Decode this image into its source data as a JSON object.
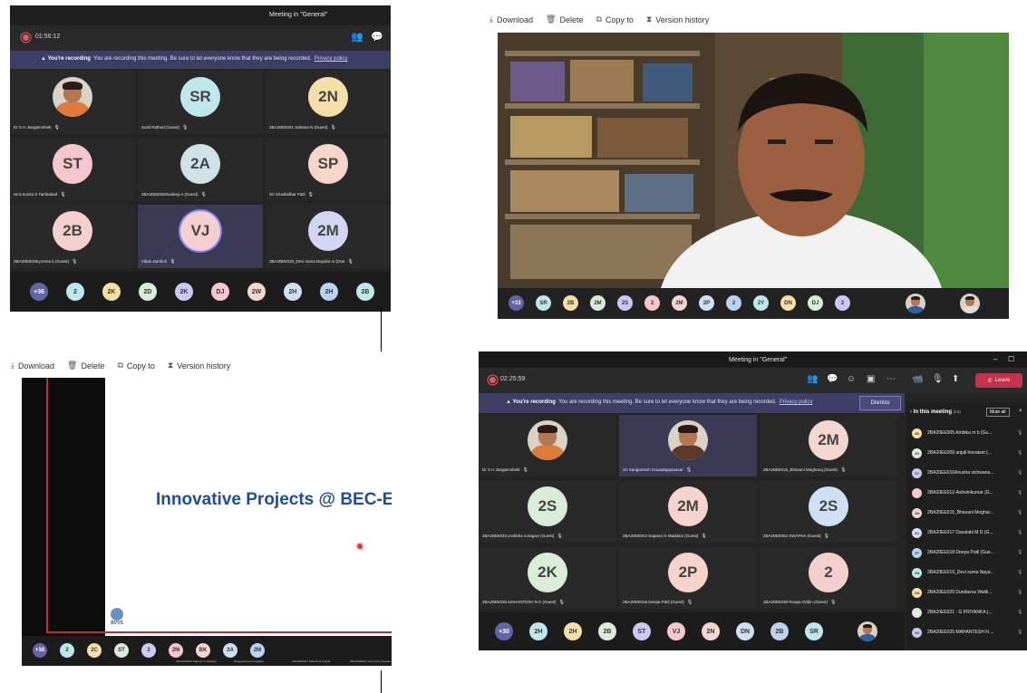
{
  "q1": {
    "meeting_title": "Meeting in \"General\"",
    "timer": "01:56:12",
    "banner_bold": "You're recording",
    "banner_text": "You are recording this meeting. Be sure to let everyone know that they are being recorded.",
    "banner_link": "Privacy policy",
    "tiles": [
      {
        "name": "Dr S H Jangamshetti",
        "initials": "",
        "color": "#ffffff"
      },
      {
        "name": "Sunil Rathod (Guest)",
        "initials": "SR",
        "color": "#bfe6ea"
      },
      {
        "name": "2BA20EE041 Sahana N (Guest)",
        "initials": "2N",
        "color": "#f5dfa9"
      },
      {
        "name": "Smt.Sunita S Tambakad",
        "initials": "ST",
        "color": "#f6c6cd"
      },
      {
        "name": "2BA20EE050Sudeep A (Guest)",
        "initials": "2A",
        "color": "#cfe3e7"
      },
      {
        "name": "Sri Shashidhar Patil",
        "initials": "SP",
        "color": "#f7d5c8"
      },
      {
        "name": "2BA20EE036.prema b (Guest)",
        "initials": "2B",
        "color": "#f3cfcd"
      },
      {
        "name": "Vikas Jambori",
        "initials": "VJ",
        "color": "#f4cfcd"
      },
      {
        "name": "2BA20EE019_Devi suma Nayaka m (Gue",
        "initials": "2M",
        "color": "#d2d6f4"
      }
    ],
    "strip": [
      "+36",
      "2",
      "2K",
      "2D",
      "2K",
      "DJ",
      "2W",
      "2H",
      "2H",
      "2B"
    ]
  },
  "q2": {
    "toolbar": {
      "download": "Download",
      "delete": "Delete",
      "copy": "Copy to",
      "history": "Version history"
    },
    "strip": [
      "+33",
      "SR",
      "2B",
      "2M",
      "2S",
      "2",
      "2M",
      "2P",
      "2",
      "2Y",
      "DN",
      "DJ",
      "2"
    ]
  },
  "q3": {
    "toolbar": {
      "download": "Download",
      "delete": "Delete",
      "copy": "Copy to",
      "history": "Version history"
    },
    "slide_title": "Innovative Projects @ BEC-EEE",
    "logo_text": "BVVS",
    "strip": [
      "+38",
      "2",
      "2C",
      "ST",
      "2",
      "2M",
      "BK",
      "2A",
      "2M"
    ],
    "strip_names": [
      "2BA20EE043 Sapana G Maddani",
      "Bhagyashree.kondagikar",
      "2BA20EE041 Sahana N Angadi",
      "2BA20EE019_Devi suma Nayaka",
      "Dr S H Jang"
    ]
  },
  "q4": {
    "meeting_title": "Meeting in \"General\"",
    "timer": "02:25:59",
    "leave": "Leave",
    "dismiss": "Dismiss",
    "banner_bold": "You're recording",
    "banner_text": "You are recording this meeting. Be sure to let everyone know that they are being recorded.",
    "banner_link": "Privacy policy",
    "tiles": [
      {
        "name": "Dr S H Jangamshetti",
        "initials": "",
        "color": "#ffffff"
      },
      {
        "name": "Sri Sangamesh Gouadappanavar",
        "initials": "",
        "color": "#ffffff"
      },
      {
        "name": "2BA20EE015_Bhavani Megharaj (Guest)",
        "initials": "2M",
        "color": "#f3d6cf"
      },
      {
        "name": "2BA20EE033 prabbha soragavi (Guest)",
        "initials": "2S",
        "color": "#d8ecd7"
      },
      {
        "name": "2BA20EE043 Sapana G Maddani (Guest)",
        "initials": "2M",
        "color": "#f6d4cd"
      },
      {
        "name": "2BA20EE052 SWAPNA (Guest)",
        "initials": "2S",
        "color": "#cfe0f5"
      },
      {
        "name": "2BA20EE025 MAHANTESH N K (Guest)",
        "initials": "2K",
        "color": "#d8ecd7"
      },
      {
        "name": "2BA20EE018 Deepa Patil (Guest)",
        "initials": "2P",
        "color": "#f6d3ca"
      },
      {
        "name": "2BA20EE038 Roopa Oddin (Guest)",
        "initials": "2",
        "color": "#f5cfcf"
      }
    ],
    "strip": [
      "+30",
      "2H",
      "2H",
      "2B",
      "ST",
      "VJ",
      "2N",
      "DN",
      "2B",
      "SR"
    ],
    "panel_title": "In this meeting",
    "panel_count": "(43)",
    "mute_all": "Mute all",
    "participants": [
      "2BA20EE005 Ambika m b (Gu...",
      "2BA20EE009 anjali honakeri (...",
      "2BA20EE010Anusha vichwana...",
      "2BA20EE012-Ashwinkumar (G...",
      "2BA20EE015_Bhavani Meghar...",
      "2BA20EE017 Davalabi M D (G...",
      "2BA20EE018 Deepa Patil (Gue...",
      "2BA20EE019_Devi suma Naya...",
      "2BA20EE020 Dundavva Walik...",
      "2BA20EE021 - G PRIYANKA (...",
      "2BA20EE025 MAHANTESH N ..."
    ],
    "participant_initials": [
      "2B",
      "2H",
      "2V",
      "",
      "2M",
      "2D",
      "2P",
      "2M",
      "2W",
      "",
      "2N"
    ]
  }
}
